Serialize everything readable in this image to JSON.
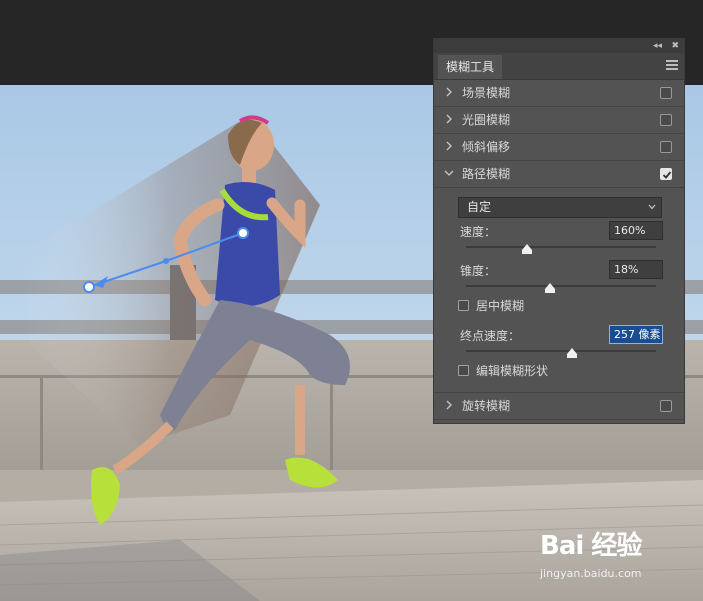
{
  "panel": {
    "title_tab": "模糊工具",
    "items": [
      {
        "label": "场景模糊",
        "checked": false
      },
      {
        "label": "光圈模糊",
        "checked": false
      },
      {
        "label": "倾斜偏移",
        "checked": false
      },
      {
        "label": "路径模糊",
        "checked": true
      },
      {
        "label": "旋转模糊",
        "checked": false
      }
    ],
    "path_blur": {
      "preset": "自定",
      "speed_label": "速度：",
      "speed_value": "160%",
      "speed_fraction": 0.32,
      "taper_label": "锥度：",
      "taper_value": "18%",
      "taper_fraction": 0.44,
      "center_blur_label": "居中模糊",
      "center_blur_checked": false,
      "end_speed_label": "终点速度：",
      "end_speed_value": "257 像素",
      "end_speed_fraction": 0.56,
      "edit_shape_label": "编辑模糊形状",
      "edit_shape_checked": false
    }
  },
  "watermark": {
    "brand": "Bai 经验",
    "url": "jingyan.baidu.com"
  },
  "colors": {
    "panel_bg": "#535353",
    "app_bg": "#262626",
    "highlight": "#1a4d8f",
    "blur_path": "#4a8cf0"
  }
}
